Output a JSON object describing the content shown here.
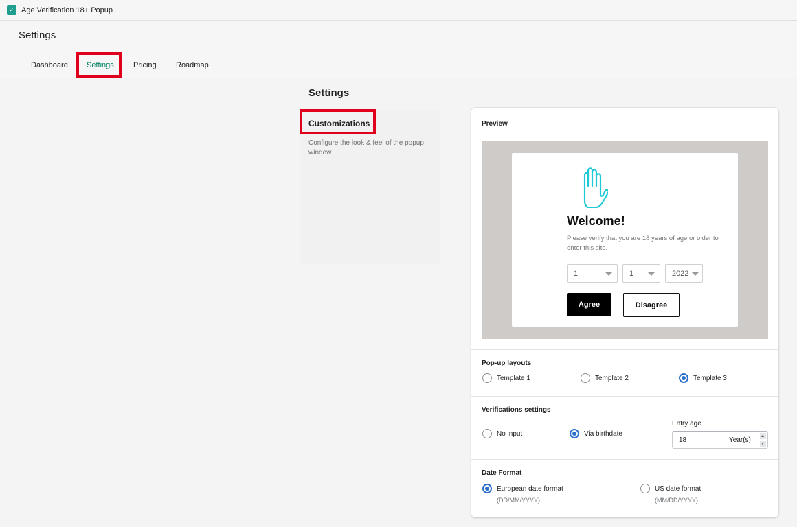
{
  "app": {
    "name": "Age Verification 18+ Popup"
  },
  "page": {
    "title": "Settings"
  },
  "tabs": [
    {
      "label": "Dashboard",
      "active": false
    },
    {
      "label": "Settings",
      "active": true
    },
    {
      "label": "Pricing",
      "active": false
    },
    {
      "label": "Roadmap",
      "active": false
    }
  ],
  "section": {
    "title": "Settings",
    "customizations_title": "Customizations",
    "customizations_desc": "Configure the look & feel of the popup window"
  },
  "preview": {
    "label": "Preview",
    "popup": {
      "icon": "hand-stop-icon",
      "title": "Welcome!",
      "desc": "Please verify that you are 18 years of age or older to enter this site.",
      "day": "1",
      "month": "1",
      "year": "2022",
      "agree_label": "Agree",
      "disagree_label": "Disagree"
    }
  },
  "layouts": {
    "label": "Pop-up layouts",
    "options": [
      "Template 1",
      "Template 2",
      "Template 3"
    ],
    "selected": "Template 3"
  },
  "verification": {
    "label": "Verifications settings",
    "options": [
      "No input",
      "Via birthdate"
    ],
    "selected": "Via birthdate",
    "entry_age_label": "Entry age",
    "entry_age_value": "18",
    "entry_age_suffix": "Year(s)"
  },
  "date_format": {
    "label": "Date Format",
    "options": [
      {
        "label": "European date format",
        "note": "(DD/MM/YYYY)"
      },
      {
        "label": "US date format",
        "note": "(MM/DD/YYYY)"
      }
    ],
    "selected": "European date format"
  },
  "colors": {
    "accent": "#008060",
    "radio": "#2c6ecb",
    "highlight": "#e0001b",
    "popup_icon": "#1ec9d6"
  }
}
